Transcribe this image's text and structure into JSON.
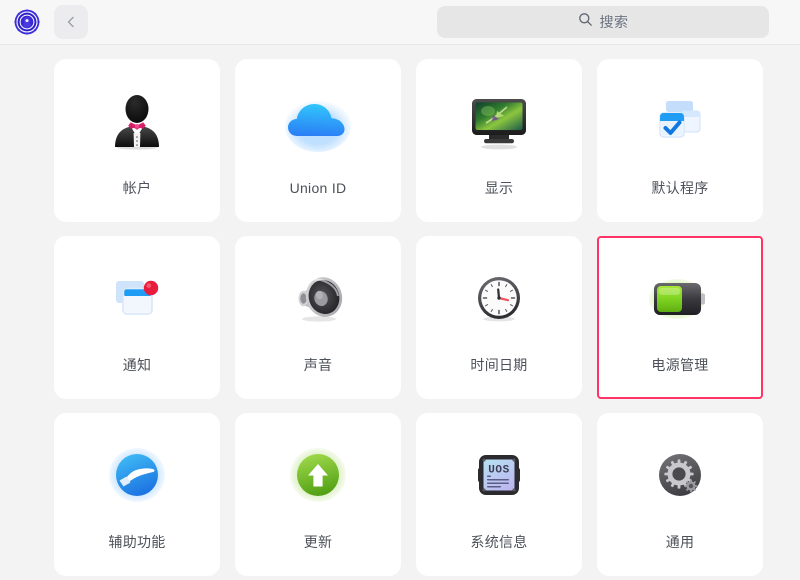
{
  "window": {
    "app_logo_icon": "control-center-gear-logo",
    "back_button_icon": "chevron-left-icon"
  },
  "search": {
    "icon": "search-icon",
    "placeholder": "搜索",
    "value": ""
  },
  "grid": {
    "items": [
      {
        "id": "accounts",
        "label": "帐户",
        "icon": "user-tuxedo-icon",
        "selected": false
      },
      {
        "id": "union-id",
        "label": "Union ID",
        "icon": "cloud-icon",
        "selected": false
      },
      {
        "id": "display",
        "label": "显示",
        "icon": "monitor-icon",
        "selected": false
      },
      {
        "id": "default-app",
        "label": "默认程序",
        "icon": "windows-checkmark-icon",
        "selected": false
      },
      {
        "id": "notification",
        "label": "通知",
        "icon": "window-badge-icon",
        "selected": false
      },
      {
        "id": "sound",
        "label": "声音",
        "icon": "speaker-icon",
        "selected": false
      },
      {
        "id": "datetime",
        "label": "时间日期",
        "icon": "clock-icon",
        "selected": false
      },
      {
        "id": "power",
        "label": "电源管理",
        "icon": "battery-icon",
        "selected": true
      },
      {
        "id": "accessibility",
        "label": "辅助功能",
        "icon": "open-hand-icon",
        "selected": false
      },
      {
        "id": "update",
        "label": "更新",
        "icon": "arrow-up-circle-icon",
        "selected": false
      },
      {
        "id": "system-info",
        "label": "系统信息",
        "icon": "uos-chip-icon",
        "selected": false
      },
      {
        "id": "general",
        "label": "通用",
        "icon": "gear-circle-icon",
        "selected": false
      }
    ]
  },
  "colors": {
    "selection_border": "#ff3366",
    "page_background": "#f3f3f4",
    "tile_background": "#ffffff",
    "label_text": "#4c5159",
    "search_background": "#e6e6e7"
  }
}
